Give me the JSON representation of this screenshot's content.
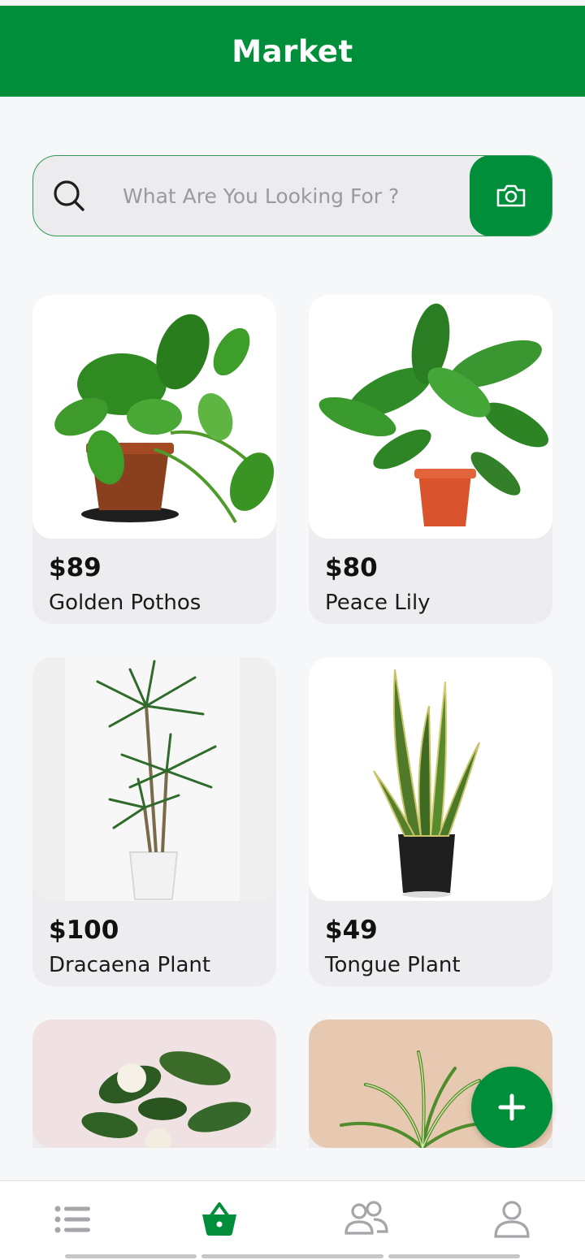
{
  "header": {
    "title": "Market"
  },
  "search": {
    "placeholder": "What Are You Looking For ?",
    "value": ""
  },
  "products": [
    {
      "price": "$89",
      "name": "Golden Pothos"
    },
    {
      "price": "$80",
      "name": "Peace Lily"
    },
    {
      "price": "$100",
      "name": "Dracaena Plant"
    },
    {
      "price": "$49",
      "name": "Tongue Plant"
    },
    {
      "price": "",
      "name": ""
    },
    {
      "price": "",
      "name": ""
    }
  ],
  "icons": {
    "search": "search-icon",
    "camera": "camera-icon",
    "add": "plus-icon",
    "nav": [
      "list-icon",
      "basket-icon",
      "users-icon",
      "profile-icon"
    ]
  },
  "bottom_nav": {
    "active_index": 1
  },
  "colors": {
    "brand": "#008e3a",
    "background": "#f6f7f9",
    "card": "#ededef",
    "nav_inactive": "#9a9aa0"
  }
}
